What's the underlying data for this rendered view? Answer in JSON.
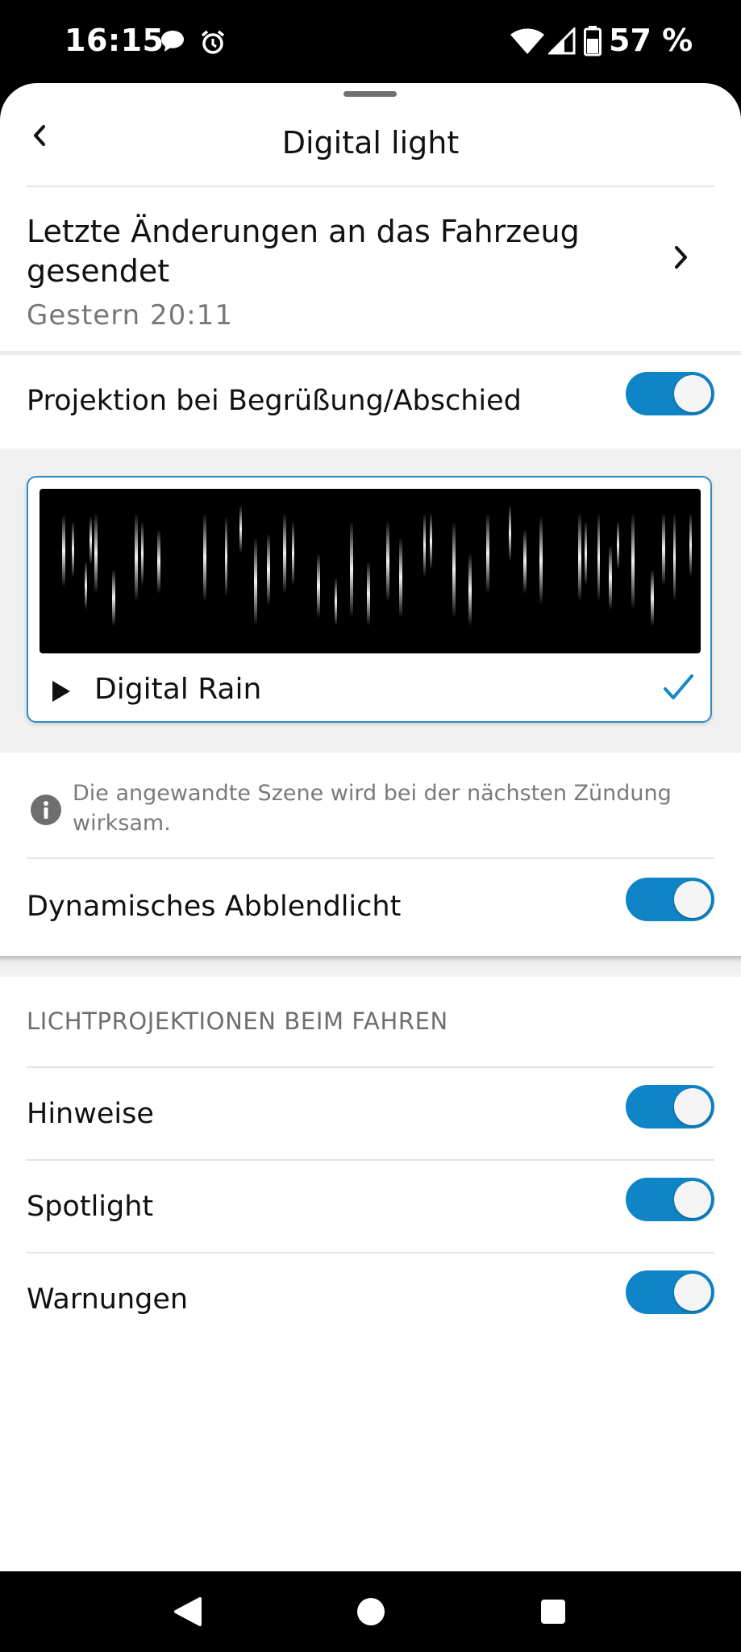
{
  "status_bar": {
    "time": "16:15",
    "battery": "57 %",
    "icons": [
      "chat-bubble-icon",
      "alarm-icon",
      "wifi-icon",
      "signal-icon",
      "battery-icon"
    ]
  },
  "header": {
    "title": "Digital light"
  },
  "last_changes": {
    "title": "Letzte Änderungen an das Fahrzeug gesendet",
    "subtitle": "Gestern 20:11"
  },
  "projection": {
    "label": "Projektion bei Begrüßung/Abschied",
    "enabled": true
  },
  "scene": {
    "name": "Digital Rain",
    "selected": true
  },
  "info": {
    "text": "Die angewandte Szene wird bei der nächsten Zündung wirksam."
  },
  "dynamic_low_beam": {
    "label": "Dynamisches Abblendlicht",
    "enabled": true
  },
  "driving_section": {
    "heading": "LICHTPROJEKTIONEN BEIM FAHREN",
    "items": [
      {
        "label": "Hinweise",
        "enabled": true
      },
      {
        "label": "Spotlight",
        "enabled": true
      },
      {
        "label": "Warnungen",
        "enabled": true
      }
    ]
  },
  "colors": {
    "accent": "#0f85c8",
    "card_border": "#2f8cc2",
    "band": "#f1f1f1"
  }
}
